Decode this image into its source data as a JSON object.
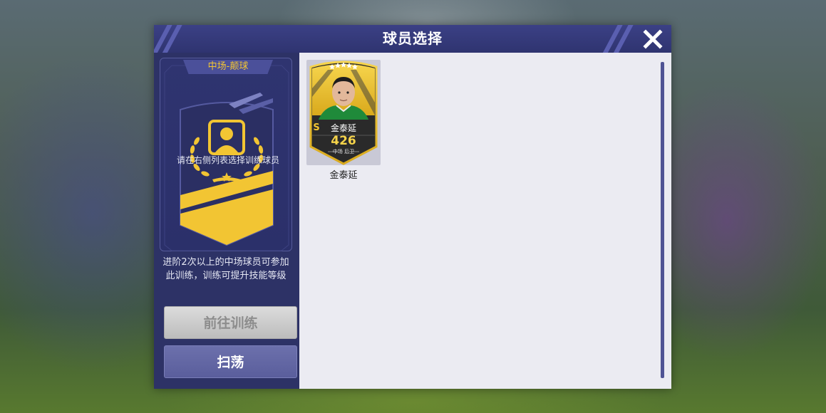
{
  "dialog": {
    "title": "球员选择"
  },
  "left_panel": {
    "category_label": "中场-颠球",
    "empty_hint": "请在右侧列表选择训练球员",
    "description": "进阶2次以上的中场球员可参加此训练，训练可提升技能等级",
    "train_button": "前往训练",
    "sweep_button": "扫荡"
  },
  "players": [
    {
      "name": "金泰延",
      "grade": "S",
      "stars": 5,
      "rating": "426",
      "positions": "中场 后卫"
    }
  ],
  "colors": {
    "dialog_bg": "#2d3266",
    "accent_gold": "#f2c533",
    "list_bg": "#ebebf2"
  }
}
